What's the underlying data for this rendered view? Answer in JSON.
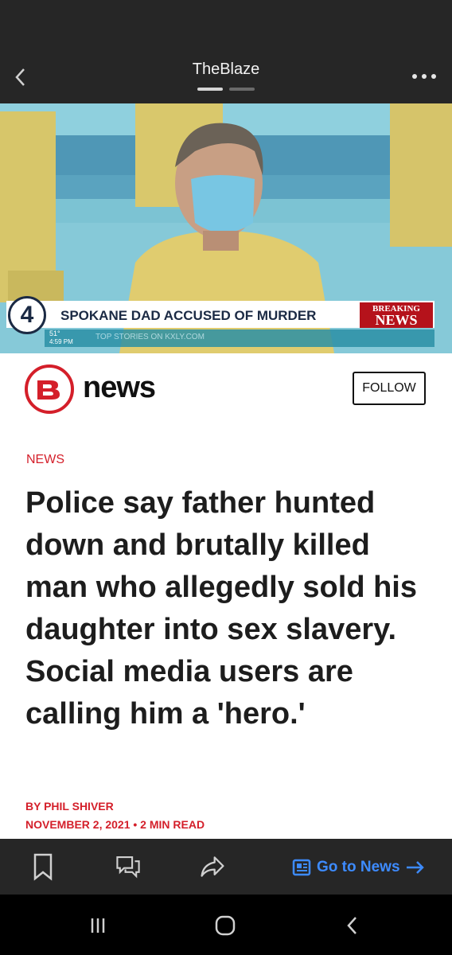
{
  "header": {
    "title": "TheBlaze",
    "back_icon": "chevron-left-icon",
    "more_icon": "more-dots-icon"
  },
  "hero_image": {
    "station_number": "4",
    "chyron": "SPOKANE DAD ACCUSED OF MURDER",
    "breaking_top": "BREAKING",
    "breaking_bottom": "NEWS",
    "temperature": "51°",
    "time": "4:59 PM",
    "ticker": "TOP STORIES ON KXLY.COM"
  },
  "publisher": {
    "logo_word": "news",
    "follow_label": "FOLLOW"
  },
  "article": {
    "section": "NEWS",
    "headline": "Police say father hunted down and brutally killed man who allegedly sold his daughter into sex slavery. Social media users are calling him a 'hero.'",
    "byline": "BY PHIL SHIVER",
    "dateline": "NOVEMBER 2, 2021 • 2 MIN READ"
  },
  "toolbar": {
    "goto_label": "Go to News"
  },
  "colors": {
    "brand_red": "#d41f2a",
    "link_blue": "#3d8bff",
    "dark_bg": "#262626"
  }
}
